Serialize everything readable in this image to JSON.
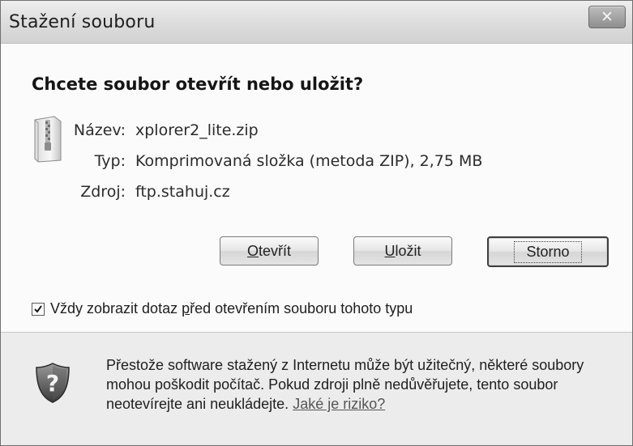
{
  "window": {
    "title": "Stažení souboru",
    "close_label": "✕"
  },
  "dialog": {
    "question": "Chcete soubor otevřít nebo uložit?",
    "file": {
      "icon": "zip-file-icon",
      "name_label": "Název:",
      "name_value": "xplorer2_lite.zip",
      "type_label": "Typ:",
      "type_value": "Komprimovaná složka (metoda ZIP), 2,75 MB",
      "source_label": "Zdroj:",
      "source_value": "ftp.stahuj.cz"
    },
    "buttons": {
      "open_prefix": "O",
      "open_rest": "tevřít",
      "save_prefix": "U",
      "save_rest": "ložit",
      "cancel": "Storno"
    },
    "checkbox": {
      "checked": true,
      "label_pre": "Vždy zobrazit dotaz ",
      "label_accel": "p",
      "label_post": "řed otevřením souboru tohoto typu"
    }
  },
  "footer": {
    "icon": "security-shield-question-icon",
    "warning": "Přestože software stažený z Internetu může být užitečný, některé soubory mohou poškodit počítač. Pokud zdroji plně nedůvěřujete, tento soubor neotevírejte ani neukládejte.",
    "risk_link": "Jaké je riziko?"
  }
}
